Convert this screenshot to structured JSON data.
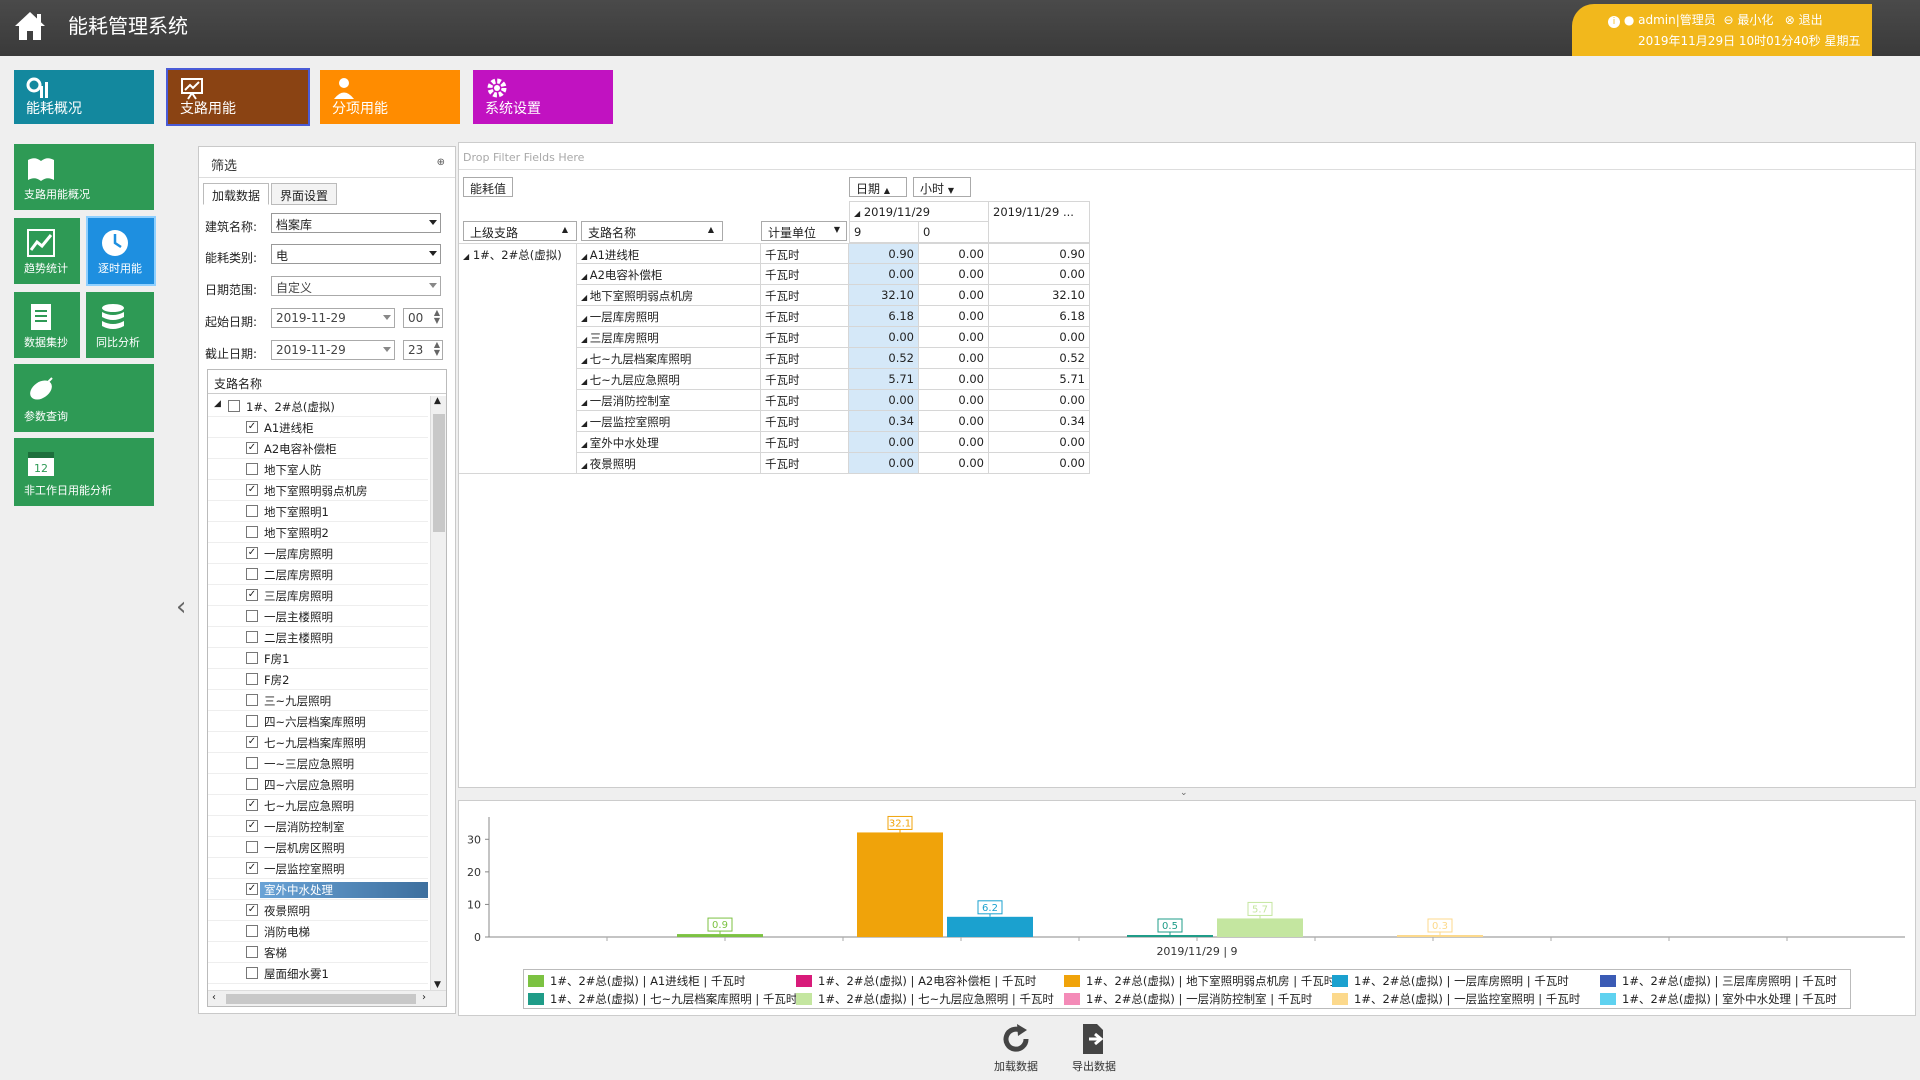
{
  "app": {
    "title": "能耗管理系统"
  },
  "user": {
    "name": "admin|管理员",
    "minimize": "最小化",
    "logout": "退出",
    "datetime": "2019年11月29日 10时01分40秒 星期五"
  },
  "colors": {
    "top_bar": "#3f3f3f",
    "user_box": "#f2b81c",
    "tile_overview": "#13889e",
    "tile_branch": "#8a4313",
    "tile_sub": "#ff8c00",
    "tile_settings": "#c112c1",
    "side_green": "#2e9a55",
    "side_active": "#1e8fe0"
  },
  "top_tiles": [
    {
      "label": "能耗概况",
      "icon": "chart-icon"
    },
    {
      "label": "支路用能",
      "icon": "presentation-icon"
    },
    {
      "label": "分项用能",
      "icon": "user-icon"
    },
    {
      "label": "系统设置",
      "icon": "gear-icon"
    }
  ],
  "side_menu": [
    {
      "label": "支路用能概况",
      "icon": "book-icon"
    },
    {
      "label": "趋势统计",
      "icon": "trend-icon"
    },
    {
      "label": "逐时用能",
      "icon": "clock-icon"
    },
    {
      "label": "数据集抄",
      "icon": "document-icon"
    },
    {
      "label": "同比分析",
      "icon": "database-icon"
    },
    {
      "label": "参数查询",
      "icon": "satellite-icon"
    },
    {
      "label": "非工作日用能分析",
      "icon": "calendar-icon",
      "calendar_day": "12"
    }
  ],
  "filter": {
    "title": "筛选",
    "tabs": [
      "加载数据",
      "界面设置"
    ],
    "building_label": "建筑名称:",
    "building_value": "档案库",
    "energy_label": "能耗类别:",
    "energy_value": "电",
    "range_label": "日期范围:",
    "range_value": "自定义",
    "start_label": "起始日期:",
    "start_date": "2019-11-29",
    "start_hour": "00",
    "end_label": "截止日期:",
    "end_date": "2019-11-29",
    "end_hour": "23",
    "tree_header": "支路名称",
    "tree_root": "1#、2#总(虚拟)",
    "tree_items": [
      {
        "label": "A1进线柜",
        "checked": true
      },
      {
        "label": "A2电容补偿柜",
        "checked": true
      },
      {
        "label": "地下室人防",
        "checked": false
      },
      {
        "label": "地下室照明弱点机房",
        "checked": true
      },
      {
        "label": "地下室照明1",
        "checked": false
      },
      {
        "label": "地下室照明2",
        "checked": false
      },
      {
        "label": "一层库房照明",
        "checked": true
      },
      {
        "label": "二层库房照明",
        "checked": false
      },
      {
        "label": "三层库房照明",
        "checked": true
      },
      {
        "label": "一层主楼照明",
        "checked": false
      },
      {
        "label": "二层主楼照明",
        "checked": false
      },
      {
        "label": "F房1",
        "checked": false
      },
      {
        "label": "F房2",
        "checked": false
      },
      {
        "label": "三~九层照明",
        "checked": false
      },
      {
        "label": "四~六层档案库照明",
        "checked": false
      },
      {
        "label": "七~九层档案库照明",
        "checked": true
      },
      {
        "label": "一~三层应急照明",
        "checked": false
      },
      {
        "label": "四~六层应急照明",
        "checked": false
      },
      {
        "label": "七~九层应急照明",
        "checked": true
      },
      {
        "label": "一层消防控制室",
        "checked": true
      },
      {
        "label": "一层机房区照明",
        "checked": false
      },
      {
        "label": "一层监控室照明",
        "checked": true
      },
      {
        "label": "室外中水处理",
        "checked": true,
        "selected": true
      },
      {
        "label": "夜景照明",
        "checked": true
      },
      {
        "label": "消防电梯",
        "checked": false
      },
      {
        "label": "客梯",
        "checked": false
      },
      {
        "label": "屋面细水雾1",
        "checked": false
      }
    ]
  },
  "pivot": {
    "drop_hint": "Drop Filter Fields Here",
    "data_field": "能耗值",
    "col_fields": [
      "日期",
      "小时"
    ],
    "row_fields": [
      "上级支路",
      "支路名称",
      "计量单位"
    ],
    "date_header": "2019/11/29",
    "date_total_header": "2019/11/29 ...",
    "hours": [
      "9",
      "0"
    ],
    "parent": "1#、2#总(虚拟)",
    "rows": [
      {
        "name": "A1进线柜",
        "unit": "千瓦时",
        "v9": "0.90",
        "v0": "0.00",
        "total": "0.90"
      },
      {
        "name": "A2电容补偿柜",
        "unit": "千瓦时",
        "v9": "0.00",
        "v0": "0.00",
        "total": "0.00"
      },
      {
        "name": "地下室照明弱点机房",
        "unit": "千瓦时",
        "v9": "32.10",
        "v0": "0.00",
        "total": "32.10"
      },
      {
        "name": "一层库房照明",
        "unit": "千瓦时",
        "v9": "6.18",
        "v0": "0.00",
        "total": "6.18"
      },
      {
        "name": "三层库房照明",
        "unit": "千瓦时",
        "v9": "0.00",
        "v0": "0.00",
        "total": "0.00"
      },
      {
        "name": "七~九层档案库照明",
        "unit": "千瓦时",
        "v9": "0.52",
        "v0": "0.00",
        "total": "0.52"
      },
      {
        "name": "七~九层应急照明",
        "unit": "千瓦时",
        "v9": "5.71",
        "v0": "0.00",
        "total": "5.71"
      },
      {
        "name": "一层消防控制室",
        "unit": "千瓦时",
        "v9": "0.00",
        "v0": "0.00",
        "total": "0.00"
      },
      {
        "name": "一层监控室照明",
        "unit": "千瓦时",
        "v9": "0.34",
        "v0": "0.00",
        "total": "0.34"
      },
      {
        "name": "室外中水处理",
        "unit": "千瓦时",
        "v9": "0.00",
        "v0": "0.00",
        "total": "0.00"
      },
      {
        "name": "夜景照明",
        "unit": "千瓦时",
        "v9": "0.00",
        "v0": "0.00",
        "total": "0.00"
      }
    ]
  },
  "chart_data": {
    "type": "bar",
    "categories": [
      "2019/11/29 | 9"
    ],
    "ylim": [
      0,
      35
    ],
    "yticks": [
      0,
      10,
      20,
      30
    ],
    "grid": false,
    "legend_position": "bottom",
    "series": [
      {
        "name": "1#、2#总(虚拟) | A1进线柜 | 千瓦时",
        "color": "#7cc242",
        "value": 0.9,
        "label": "0.9"
      },
      {
        "name": "1#、2#总(虚拟) | A2电容补偿柜 | 千瓦时",
        "color": "#d81b7a",
        "value": 0,
        "label": ""
      },
      {
        "name": "1#、2#总(虚拟) | 地下室照明弱点机房 | 千瓦时",
        "color": "#f0a30a",
        "value": 32.1,
        "label": "32.1"
      },
      {
        "name": "1#、2#总(虚拟) | 一层库房照明 | 千瓦时",
        "color": "#1ba1cf",
        "value": 6.2,
        "label": "6.2"
      },
      {
        "name": "1#、2#总(虚拟) | 三层库房照明 | 千瓦时",
        "color": "#3b5bb5",
        "value": 0,
        "label": ""
      },
      {
        "name": "1#、2#总(虚拟) | 七~九层档案库照明 | 千瓦时",
        "color": "#1f9c88",
        "value": 0.5,
        "label": "0.5"
      },
      {
        "name": "1#、2#总(虚拟) | 七~九层应急照明 | 千瓦时",
        "color": "#c4e6a0",
        "value": 5.7,
        "label": "5.7"
      },
      {
        "name": "1#、2#总(虚拟) | 一层消防控制室 | 千瓦时",
        "color": "#f48bb8",
        "value": 0,
        "label": ""
      },
      {
        "name": "1#、2#总(虚拟) | 一层监控室照明 | 千瓦时",
        "color": "#fcd98c",
        "value": 0.3,
        "label": "0.3"
      },
      {
        "name": "1#、2#总(虚拟) | 室外中水处理 | 千瓦时",
        "color": "#5fd2f0",
        "value": 0,
        "label": ""
      }
    ]
  },
  "bottom": {
    "reload": "加载数据",
    "export": "导出数据"
  }
}
